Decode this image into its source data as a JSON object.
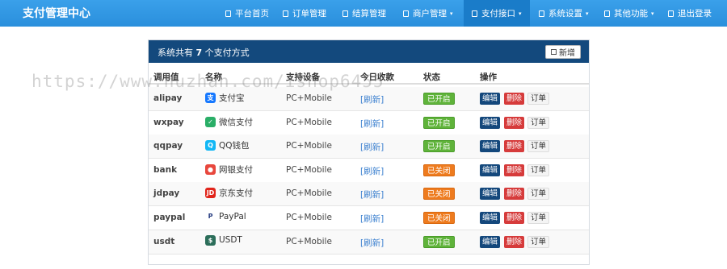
{
  "navbar": {
    "brand": "支付管理中心",
    "items": [
      {
        "label": "平台首页",
        "caret": ""
      },
      {
        "label": "订单管理",
        "caret": ""
      },
      {
        "label": "结算管理",
        "caret": ""
      },
      {
        "label": "商户管理",
        "caret": "▾"
      },
      {
        "label": "支付接口",
        "caret": "▾"
      },
      {
        "label": "系统设置",
        "caret": "▾"
      },
      {
        "label": "其他功能",
        "caret": "▾"
      },
      {
        "label": "退出登录",
        "caret": ""
      }
    ],
    "active_index": 4
  },
  "panel": {
    "title_prefix": "系统共有 ",
    "title_count": "7",
    "title_suffix": " 个支付方式",
    "new_button": "新增"
  },
  "table": {
    "headers": [
      "调用值",
      "名称",
      "支持设备",
      "今日收款",
      "状态",
      "操作"
    ],
    "rows": [
      {
        "code": "alipay",
        "name": "支付宝",
        "device": "PC+Mobile",
        "income": "[刷新]",
        "status": "已开启",
        "on": true,
        "icon": "alipay-icon"
      },
      {
        "code": "wxpay",
        "name": "微信支付",
        "device": "PC+Mobile",
        "income": "[刷新]",
        "status": "已开启",
        "on": true,
        "icon": "wechat-icon"
      },
      {
        "code": "qqpay",
        "name": "QQ钱包",
        "device": "PC+Mobile",
        "income": "[刷新]",
        "status": "已开启",
        "on": true,
        "icon": "qq-icon"
      },
      {
        "code": "bank",
        "name": "网银支付",
        "device": "PC+Mobile",
        "income": "[刷新]",
        "status": "已关闭",
        "on": false,
        "icon": "bank-icon"
      },
      {
        "code": "jdpay",
        "name": "京东支付",
        "device": "PC+Mobile",
        "income": "[刷新]",
        "status": "已关闭",
        "on": false,
        "icon": "jd-icon"
      },
      {
        "code": "paypal",
        "name": "PayPal",
        "device": "PC+Mobile",
        "income": "[刷新]",
        "status": "已关闭",
        "on": false,
        "icon": "paypal-icon"
      },
      {
        "code": "usdt",
        "name": "USDT",
        "device": "PC+Mobile",
        "income": "[刷新]",
        "status": "已开启",
        "on": true,
        "icon": "usdt-icon"
      }
    ],
    "actions": {
      "edit": "编辑",
      "delete": "删除",
      "orders": "订单"
    }
  },
  "watermark": "https://www.huzhan.com/ishop6455"
}
